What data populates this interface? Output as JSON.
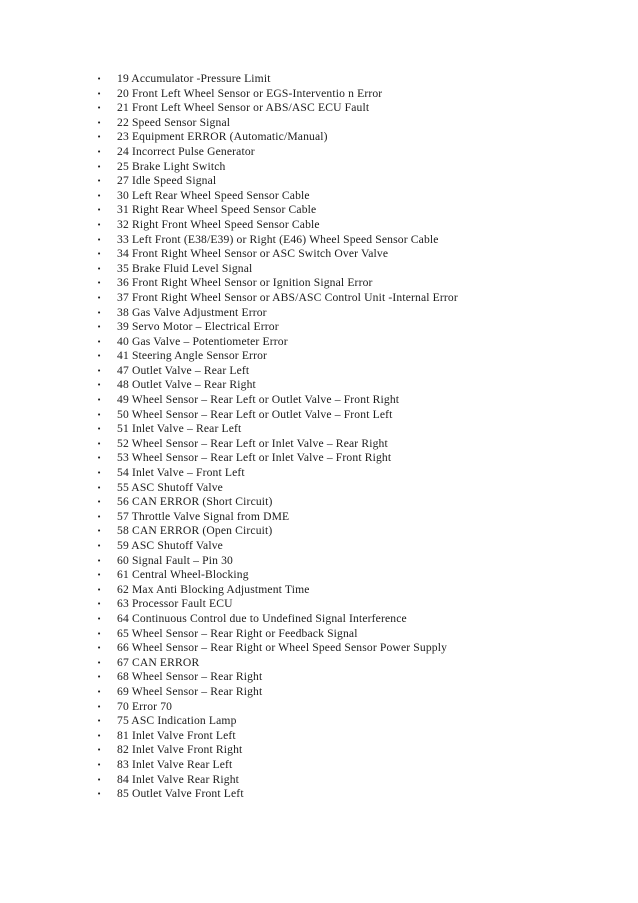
{
  "document": {
    "type": "bulleted-list",
    "bullet_glyph": "•",
    "text_color": "#1b1b1b",
    "background_color": "#ffffff",
    "fault_codes": [
      "19 Accumulator  -Pressure Limit",
      "20 Front Left Wheel Sensor or EGS-Interventio n  Error",
      "21 Front Left Wheel Sensor or ABS/ASC ECU Fault",
      "22 Speed Sensor Signal",
      "23 Equipment  ERROR  (Automatic/Manual)",
      "24 Incorrect Pulse Generator",
      "25 Brake Light Switch",
      "27 Idle Speed Signal",
      "30 Left Rear Wheel Speed Sensor Cable",
      "31 Right Rear Wheel Speed Sensor Cable",
      "32 Right Front Wheel Speed Sensor Cable",
      "33 Left Front (E38/E39) or Right (E46) Wheel Speed Sensor Cable",
      "34 Front Right Wheel Sensor or ASC Switch Over Valve",
      "35 Brake Fluid Level Signal",
      "36 Front Right Wheel Sensor or Ignition Signal Error",
      "37 Front Right Wheel Sensor or ABS/ASC Control Unit -Internal Error",
      "38 Gas Valve Adjustment Error",
      "39 Servo Motor – Electrical Error",
      "40 Gas Valve – Potentiometer Error",
      "41 Steering Angle Sensor Error",
      "47 Outlet Valve – Rear Left",
      "48 Outlet Valve – Rear Right",
      "49 Wheel Sensor – Rear Left or Outlet Valve – Front Right",
      "50 Wheel Sensor – Rear Left or Outlet Valve – Front Left",
      "51 Inlet Valve – Rear Left",
      "52 Wheel Sensor – Rear Left or Inlet Valve – Rear Right",
      "53 Wheel Sensor – Rear Left or Inlet Valve – Front Right",
      "54 Inlet Valve – Front Left",
      "55 ASC Shutoff Valve",
      "56 CAN ERROR (Short Circuit)",
      "57 Throttle Valve Signal from DME",
      "58 CAN ERROR (Open Circuit)",
      "59 ASC Shutoff Valve",
      "60 Signal Fault – Pin 30",
      "61 Central Wheel-Blocking",
      "62 Max Anti Blocking Adjustment Time",
      "63 Processor Fault ECU",
      "64 Continuous Control due to Undefined Signal Interference",
      "65 Wheel Sensor – Rear Right or Feedback Signal",
      "66 Wheel Sensor – Rear Right or Wheel Speed Sensor Power Supply",
      "67 CAN ERROR",
      "68 Wheel Sensor – Rear Right",
      "69 Wheel Sensor – Rear Right",
      "70 Error 70",
      "75 ASC Indication Lamp",
      "81 Inlet Valve Front Left",
      "82 Inlet Valve Front Right",
      "83 Inlet Valve Rear Left",
      "84 Inlet Valve Rear Right",
      "85 Outlet Valve Front Left"
    ]
  }
}
